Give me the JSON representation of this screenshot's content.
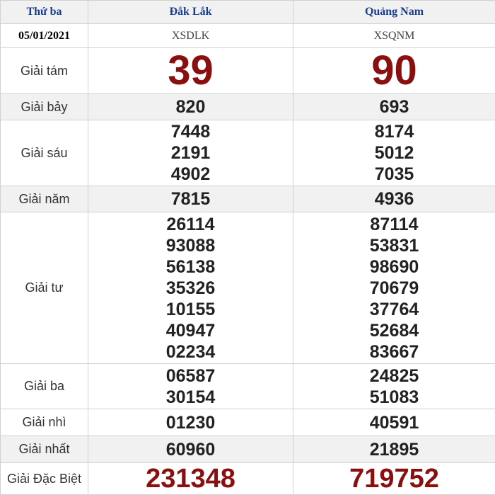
{
  "header": {
    "day": "Thứ ba",
    "date": "05/01/2021",
    "provinces": [
      {
        "name": "Đắk Lắk",
        "code": "XSDLK"
      },
      {
        "name": "Quảng Nam",
        "code": "XSQNM"
      }
    ]
  },
  "prizes": {
    "g8": {
      "label": "Giải tám",
      "p0": [
        "39"
      ],
      "p1": [
        "90"
      ]
    },
    "g7": {
      "label": "Giải bảy",
      "p0": [
        "820"
      ],
      "p1": [
        "693"
      ]
    },
    "g6": {
      "label": "Giải sáu",
      "p0": [
        "7448",
        "2191",
        "4902"
      ],
      "p1": [
        "8174",
        "5012",
        "7035"
      ]
    },
    "g5": {
      "label": "Giải năm",
      "p0": [
        "7815"
      ],
      "p1": [
        "4936"
      ]
    },
    "g4": {
      "label": "Giải tư",
      "p0": [
        "26114",
        "93088",
        "56138",
        "35326",
        "10155",
        "40947",
        "02234"
      ],
      "p1": [
        "87114",
        "53831",
        "98690",
        "70679",
        "37764",
        "52684",
        "83667"
      ]
    },
    "g3": {
      "label": "Giải ba",
      "p0": [
        "06587",
        "30154"
      ],
      "p1": [
        "24825",
        "51083"
      ]
    },
    "g2": {
      "label": "Giải nhì",
      "p0": [
        "01230"
      ],
      "p1": [
        "40591"
      ]
    },
    "g1": {
      "label": "Giải nhất",
      "p0": [
        "60960"
      ],
      "p1": [
        "21895"
      ]
    },
    "db": {
      "label": "Giải Đặc Biệt",
      "p0": [
        "231348"
      ],
      "p1": [
        "719752"
      ]
    }
  }
}
